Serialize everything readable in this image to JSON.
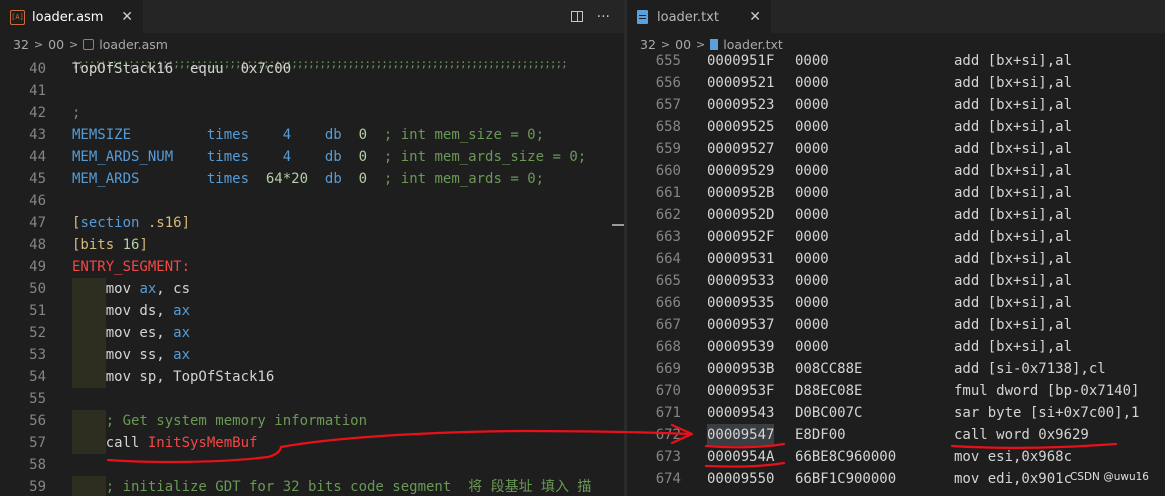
{
  "left_editor": {
    "tab_label": "loader.asm",
    "tab_icon": "asm-file-icon",
    "close_glyph": "✕",
    "more_glyph": "···",
    "breadcrumb": [
      "32",
      "00",
      "loader.asm"
    ],
    "dots": ";;;;;;;;;;;;;;;;;;;;;;;;;;;;;;;;;;;;;;;;;;;;;;;;;;;;;;;;;;;;;;;;;;;;;;;;;;;;;;;;;;;;;;;;",
    "lines": [
      {
        "n": "40",
        "tokens": [
          [
            "plain",
            "TopOfStack16  equu  0x7c00"
          ]
        ]
      },
      {
        "n": "41",
        "tokens": []
      },
      {
        "n": "42",
        "tokens": [
          [
            "cmt",
            ";"
          ]
        ]
      },
      {
        "n": "43",
        "tokens": [
          [
            "kw",
            "MEMSIZE         times    4    "
          ],
          [
            "kw",
            "db  "
          ],
          [
            "num",
            "0"
          ],
          [
            "cmt",
            "  ; int mem_size = 0;"
          ]
        ]
      },
      {
        "n": "44",
        "tokens": [
          [
            "kw",
            "MEM_ARDS_NUM    times    4    "
          ],
          [
            "kw",
            "db  "
          ],
          [
            "num",
            "0"
          ],
          [
            "cmt",
            "  ; int mem_ards_size = 0;"
          ]
        ]
      },
      {
        "n": "45",
        "tokens": [
          [
            "kw",
            "MEM_ARDS        times  "
          ],
          [
            "num",
            "64*20"
          ],
          [
            "kw",
            "  db  "
          ],
          [
            "num",
            "0"
          ],
          [
            "cmt",
            "  ; int mem_ards = 0;"
          ]
        ]
      },
      {
        "n": "46",
        "tokens": []
      },
      {
        "n": "47",
        "tokens": [
          [
            "sec",
            "["
          ],
          [
            "kw",
            "section"
          ],
          [
            "sec",
            " .s16]"
          ]
        ]
      },
      {
        "n": "48",
        "tokens": [
          [
            "sec",
            "[bits "
          ],
          [
            "num",
            "16"
          ],
          [
            "sec",
            "]"
          ]
        ]
      },
      {
        "n": "49",
        "tokens": [
          [
            "lbl",
            "ENTRY_SEGMENT:"
          ]
        ]
      },
      {
        "n": "50",
        "indent": true,
        "tokens": [
          [
            "plain",
            "    mov "
          ],
          [
            "reg",
            "ax"
          ],
          [
            "plain",
            ", cs"
          ]
        ]
      },
      {
        "n": "51",
        "indent": true,
        "tokens": [
          [
            "plain",
            "    mov ds, "
          ],
          [
            "reg",
            "ax"
          ]
        ]
      },
      {
        "n": "52",
        "indent": true,
        "tokens": [
          [
            "plain",
            "    mov es, "
          ],
          [
            "reg",
            "ax"
          ]
        ]
      },
      {
        "n": "53",
        "indent": true,
        "tokens": [
          [
            "plain",
            "    mov ss, "
          ],
          [
            "reg",
            "ax"
          ]
        ]
      },
      {
        "n": "54",
        "indent": true,
        "tokens": [
          [
            "plain",
            "    mov sp, TopOfStack16"
          ]
        ]
      },
      {
        "n": "55",
        "tokens": []
      },
      {
        "n": "56",
        "indent": true,
        "tokens": [
          [
            "cmt",
            "    ; Get system memory information"
          ]
        ]
      },
      {
        "n": "57",
        "indent": true,
        "tokens": [
          [
            "plain",
            "    call "
          ],
          [
            "lbl",
            "InitSysMemBuf"
          ]
        ]
      },
      {
        "n": "58",
        "tokens": []
      },
      {
        "n": "59",
        "indent": true,
        "tokens": [
          [
            "cmt",
            "    ; initialize GDT for 32 bits code segment  将 段基址 填入 描"
          ]
        ]
      }
    ]
  },
  "right_editor": {
    "tab_label": "loader.txt",
    "tab_icon": "text-file-icon",
    "close_glyph": "✕",
    "breadcrumb": [
      "32",
      "00",
      "loader.txt"
    ],
    "lines": [
      {
        "n": "655",
        "addr": "0000951F",
        "hex": "0000",
        "ins": "add [bx+si],al"
      },
      {
        "n": "656",
        "addr": "00009521",
        "hex": "0000",
        "ins": "add [bx+si],al"
      },
      {
        "n": "657",
        "addr": "00009523",
        "hex": "0000",
        "ins": "add [bx+si],al"
      },
      {
        "n": "658",
        "addr": "00009525",
        "hex": "0000",
        "ins": "add [bx+si],al"
      },
      {
        "n": "659",
        "addr": "00009527",
        "hex": "0000",
        "ins": "add [bx+si],al"
      },
      {
        "n": "660",
        "addr": "00009529",
        "hex": "0000",
        "ins": "add [bx+si],al"
      },
      {
        "n": "661",
        "addr": "0000952B",
        "hex": "0000",
        "ins": "add [bx+si],al"
      },
      {
        "n": "662",
        "addr": "0000952D",
        "hex": "0000",
        "ins": "add [bx+si],al"
      },
      {
        "n": "663",
        "addr": "0000952F",
        "hex": "0000",
        "ins": "add [bx+si],al"
      },
      {
        "n": "664",
        "addr": "00009531",
        "hex": "0000",
        "ins": "add [bx+si],al"
      },
      {
        "n": "665",
        "addr": "00009533",
        "hex": "0000",
        "ins": "add [bx+si],al"
      },
      {
        "n": "666",
        "addr": "00009535",
        "hex": "0000",
        "ins": "add [bx+si],al"
      },
      {
        "n": "667",
        "addr": "00009537",
        "hex": "0000",
        "ins": "add [bx+si],al"
      },
      {
        "n": "668",
        "addr": "00009539",
        "hex": "0000",
        "ins": "add [bx+si],al"
      },
      {
        "n": "669",
        "addr": "0000953B",
        "hex": "008CC88E",
        "ins": "add [si-0x7138],cl"
      },
      {
        "n": "670",
        "addr": "0000953F",
        "hex": "D88EC08E",
        "ins": "fmul dword [bp-0x7140]"
      },
      {
        "n": "671",
        "addr": "00009543",
        "hex": "D0BC007C",
        "ins": "sar byte [si+0x7c00],1"
      },
      {
        "n": "672",
        "addr": "00009547",
        "hex": "E8DF00",
        "ins": "call word 0x9629",
        "selected": true
      },
      {
        "n": "673",
        "addr": "0000954A",
        "hex": "66BE8C960000",
        "ins": "mov esi,0x968c"
      },
      {
        "n": "674",
        "addr": "00009550",
        "hex": "66BF1C900000",
        "ins": "mov edi,0x901c"
      }
    ]
  },
  "watermark": "CSDN @uwu16",
  "colors": {
    "annotation": "#e8111a",
    "background": "#1e1e1e"
  }
}
